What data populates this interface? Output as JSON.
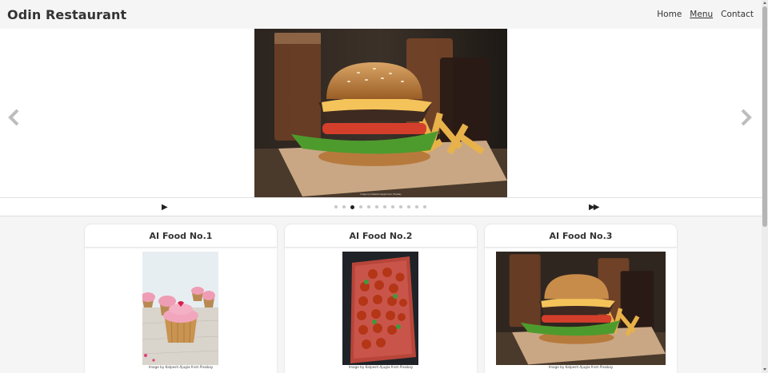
{
  "header": {
    "brand": "Odin Restaurant",
    "nav": [
      {
        "label": "Home",
        "active": false
      },
      {
        "label": "Menu",
        "active": true
      },
      {
        "label": "Contact",
        "active": false
      }
    ]
  },
  "carousel": {
    "prev_icon": "chevron-left-icon",
    "next_icon": "chevron-right-icon",
    "play_label": "▶",
    "next_slide_label": "▶▶",
    "slide_count": 12,
    "active_slide": 3,
    "hero_credit": "Image by Kalpesh Ajugia from Pixabay"
  },
  "cards": [
    {
      "title": "AI Food No.1",
      "credit": "Image by Kalpesh Ajugia from Pixabay",
      "image": "cupcakes"
    },
    {
      "title": "AI Food No.2",
      "credit": "Image by Kalpesh Ajugia from Pixabay",
      "image": "meatballs"
    },
    {
      "title": "AI Food No.3",
      "credit": "Image by Kalpesh Ajugia from Pixabay",
      "image": "burger"
    }
  ]
}
